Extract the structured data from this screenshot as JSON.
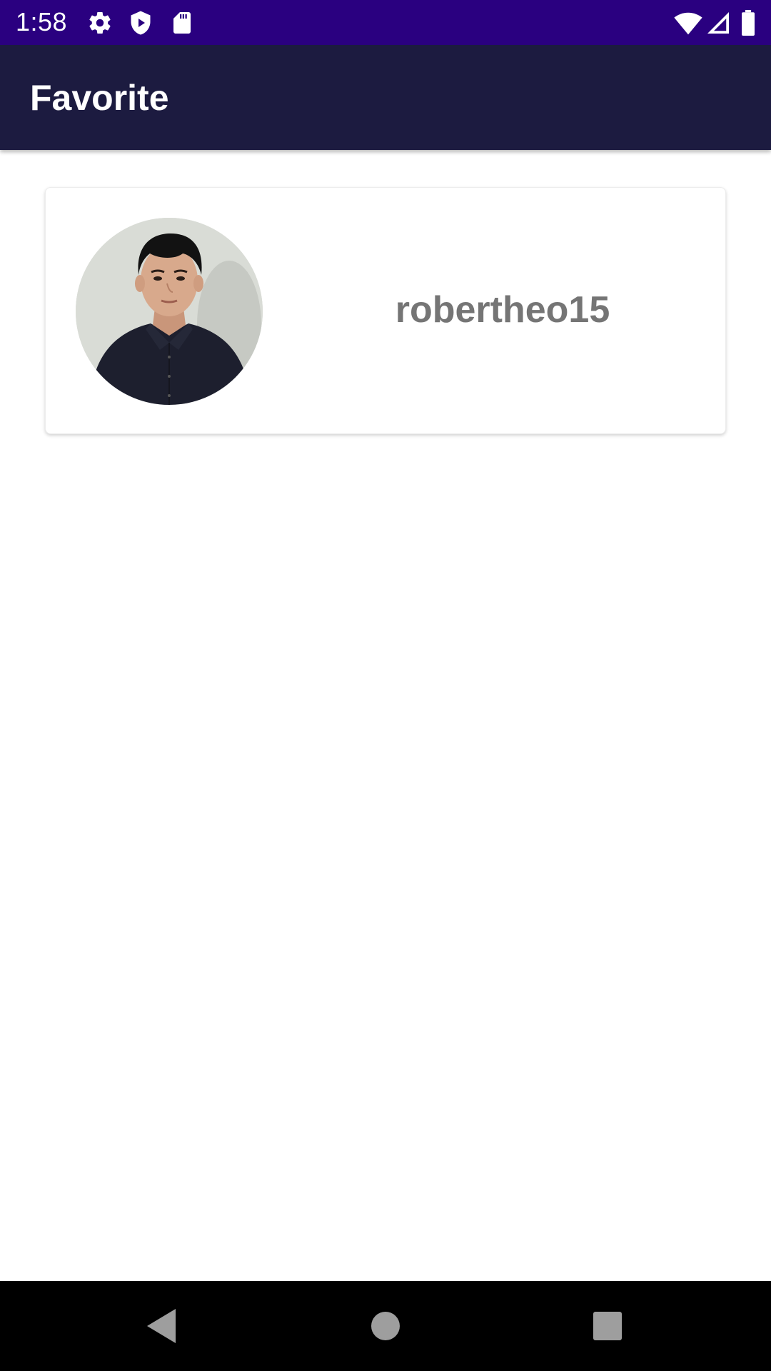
{
  "status_bar": {
    "time": "1:58",
    "icons": [
      "settings-icon",
      "shield-play-icon",
      "sd-card-icon",
      "wifi-icon",
      "cell-signal-icon",
      "battery-icon"
    ]
  },
  "app_bar": {
    "title": "Favorite"
  },
  "favorites": [
    {
      "username": "robertheo15",
      "avatar": "user-avatar-photo"
    }
  ],
  "nav_bar": {
    "buttons": [
      "back-icon",
      "home-icon",
      "recents-icon"
    ]
  },
  "colors": {
    "status_bar": "#2a0080",
    "app_bar": "#1c1b40",
    "username_text": "#757575",
    "nav_bar": "#000000"
  }
}
